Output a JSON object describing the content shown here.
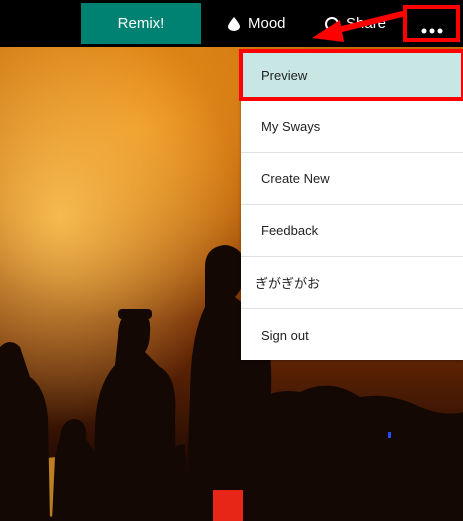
{
  "toolbar": {
    "remix_label": "Remix!",
    "mood_label": "Mood",
    "mood_icon": "drop-icon",
    "share_label": "Share",
    "share_icon": "share-icon",
    "more_icon": "ellipsis-icon"
  },
  "menu": {
    "items": [
      {
        "label": "Preview"
      },
      {
        "label": "My Sways"
      },
      {
        "label": "Create New"
      },
      {
        "label": "Feedback"
      },
      {
        "label": "ぎがぎがお"
      },
      {
        "label": "Sign out"
      }
    ]
  },
  "colors": {
    "remix_bg": "#008272",
    "highlight_border": "#ff0000",
    "preview_bg": "#c8e7e4"
  }
}
